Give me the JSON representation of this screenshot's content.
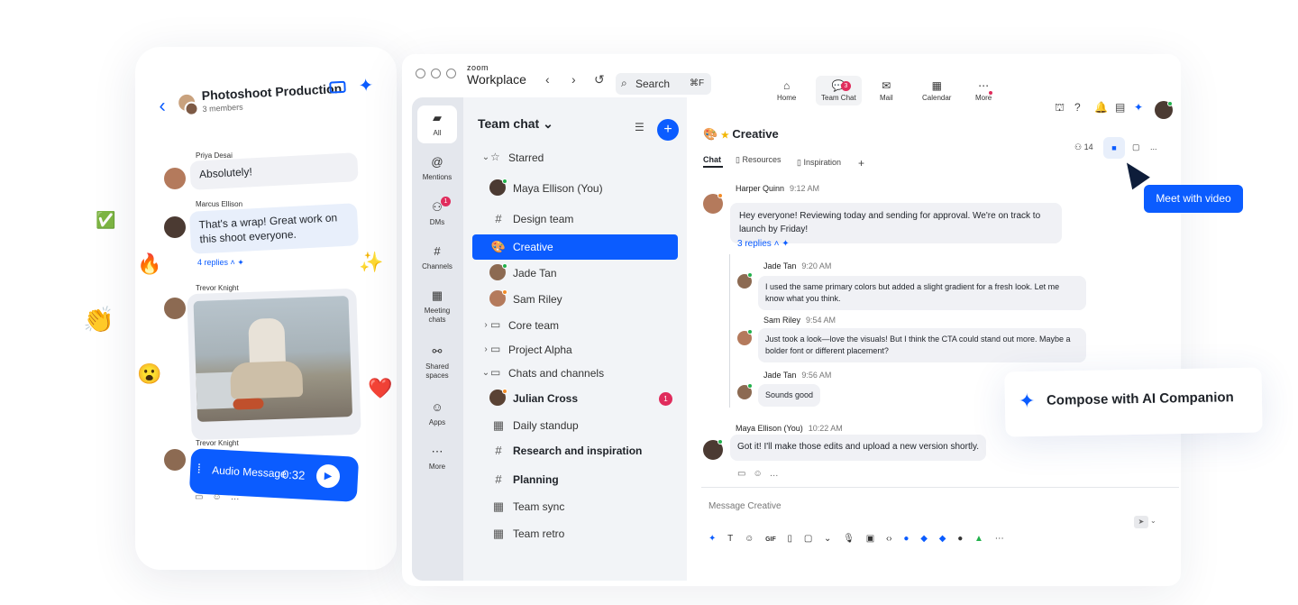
{
  "mobile": {
    "group_title": "Photoshoot Production",
    "group_subtitle": "3 members",
    "messages": [
      {
        "author": "Priya Desai",
        "text": "Absolutely!"
      },
      {
        "author": "Marcus Ellison",
        "text": "That's a wrap! Great work on this shoot everyone.",
        "replies": "4 replies"
      },
      {
        "author": "Trevor Knight",
        "image": "sneaker-photo"
      },
      {
        "author": "Trevor Knight",
        "audio_label": "Audio Message",
        "audio_time": "0:32"
      }
    ]
  },
  "window": {
    "brand_small": "zoom",
    "brand_big": "Workplace",
    "search": {
      "placeholder": "Search",
      "shortcut": "⌘F"
    },
    "top_nav": [
      {
        "label": "Home",
        "icon": "home-icon"
      },
      {
        "label": "Team Chat",
        "icon": "chat-icon",
        "badge": "3"
      },
      {
        "label": "Mail",
        "icon": "mail-icon"
      },
      {
        "label": "Calendar",
        "icon": "calendar-icon"
      },
      {
        "label": "More",
        "icon": "more-icon"
      }
    ],
    "rail": [
      {
        "label": "All",
        "icon": "chat-icon"
      },
      {
        "label": "Mentions",
        "icon": "at-icon"
      },
      {
        "label": "DMs",
        "icon": "people-icon",
        "badge": "1"
      },
      {
        "label": "Channels",
        "icon": "hash-icon"
      },
      {
        "label": "Meeting chats",
        "icon": "calendar-icon"
      },
      {
        "label": "Shared spaces",
        "icon": "share-icon"
      },
      {
        "label": "Apps",
        "icon": "apps-icon"
      },
      {
        "label": "More",
        "icon": "more-icon"
      }
    ],
    "list": {
      "title": "Team chat",
      "starred": "Starred",
      "starred_items": [
        "Maya Ellison (You)",
        "Design team",
        "Creative",
        "Jade Tan",
        "Sam Riley"
      ],
      "core_team": "Core team",
      "project_alpha": "Project Alpha",
      "chats_channels": "Chats and channels",
      "chat_items": [
        "Julian Cross",
        "Daily standup",
        "Research and inspiration",
        "Planning",
        "Team sync",
        "Team retro"
      ],
      "julian_unread": "1"
    },
    "channel": {
      "name": "Creative",
      "tabs": [
        "Chat",
        "Resources",
        "Inspiration"
      ],
      "add_tab": "+",
      "members": "14",
      "more": "...",
      "tooltip": "Meet with video"
    },
    "chat": [
      {
        "author": "Harper Quinn",
        "time": "9:12 AM",
        "text": "Hey everyone! Reviewing today and sending for approval. We're on track to launch by Friday!"
      },
      {
        "replies": "3 replies"
      },
      {
        "author": "Jade Tan",
        "time": "9:20 AM",
        "text": "I used the same primary colors but added a slight gradient for a fresh look. Let me know what you think."
      },
      {
        "author": "Sam Riley",
        "time": "9:54 AM",
        "text": "Just took a look—love the visuals! But I think the CTA could stand out more. Maybe a bolder font or different placement?"
      },
      {
        "author": "Jade Tan",
        "time": "9:56 AM",
        "text": "Sounds good"
      },
      {
        "author": "Maya Ellison (You)",
        "time": "10:22 AM",
        "text": "Got it! I'll make those edits and upload a new version shortly."
      }
    ],
    "composer_placeholder": "Message Creative",
    "toolbar_gif": "GIF"
  },
  "ai_card": {
    "text": "Compose with AI Companion"
  },
  "colors": {
    "accent": "#0b5cff",
    "badge": "#e02c5c",
    "online": "#22b14c"
  }
}
